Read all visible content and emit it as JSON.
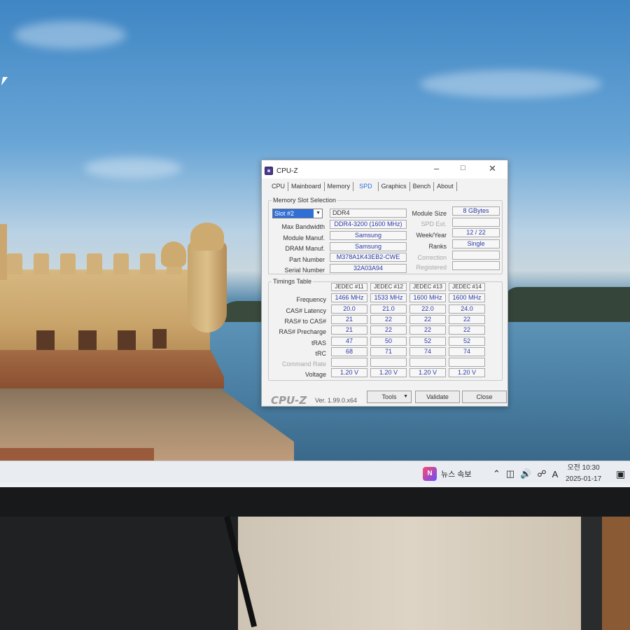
{
  "window": {
    "title": "CPU-Z",
    "minimize_icon": "minimize-icon",
    "maximize_icon": "maximize-icon",
    "close_icon": "close-icon"
  },
  "tabs": [
    "CPU",
    "Mainboard",
    "Memory",
    "SPD",
    "Graphics",
    "Bench",
    "About"
  ],
  "active_tab": "SPD",
  "slot_group": {
    "label": "Memory Slot Selection",
    "selected_slot": "Slot #2",
    "type": "DDR4",
    "module_size_label": "Module Size",
    "module_size": "8 GBytes",
    "spd_ext_label": "SPD Ext.",
    "week_year_label": "Week/Year",
    "week_year": "12 / 22",
    "ranks_label": "Ranks",
    "ranks": "Single",
    "correction_label": "Correction",
    "registered_label": "Registered",
    "max_bandwidth_label": "Max Bandwidth",
    "max_bandwidth": "DDR4-3200 (1600 MHz)",
    "module_manuf_label": "Module Manuf.",
    "module_manuf": "Samsung",
    "dram_manuf_label": "DRAM Manuf.",
    "dram_manuf": "Samsung",
    "part_number_label": "Part Number",
    "part_number": "M378A1K43EB2-CWE",
    "serial_number_label": "Serial Number",
    "serial_number": "32A03A94"
  },
  "timings": {
    "label": "Timings Table",
    "columns": [
      "JEDEC #11",
      "JEDEC #12",
      "JEDEC #13",
      "JEDEC #14"
    ],
    "rows": [
      {
        "label": "Frequency",
        "values": [
          "1466 MHz",
          "1533 MHz",
          "1600 MHz",
          "1600 MHz"
        ]
      },
      {
        "label": "CAS# Latency",
        "values": [
          "20.0",
          "21.0",
          "22.0",
          "24.0"
        ]
      },
      {
        "label": "RAS# to CAS#",
        "values": [
          "21",
          "22",
          "22",
          "22"
        ]
      },
      {
        "label": "RAS# Precharge",
        "values": [
          "21",
          "22",
          "22",
          "22"
        ]
      },
      {
        "label": "tRAS",
        "values": [
          "47",
          "50",
          "52",
          "52"
        ]
      },
      {
        "label": "tRC",
        "values": [
          "68",
          "71",
          "74",
          "74"
        ]
      },
      {
        "label": "Command Rate",
        "values": [
          "",
          "",
          "",
          ""
        ],
        "dim": true
      },
      {
        "label": "Voltage",
        "values": [
          "1.20 V",
          "1.20 V",
          "1.20 V",
          "1.20 V"
        ]
      }
    ]
  },
  "footer": {
    "logo": "CPU-Z",
    "version": "Ver. 1.99.0.x64",
    "tools_label": "Tools",
    "validate_label": "Validate",
    "close_label": "Close"
  },
  "taskbar": {
    "news_label": "뉴스 속보",
    "tray_icons": [
      "chevron-up-icon",
      "network-icon",
      "speaker-icon",
      "wifi-icon"
    ],
    "ime": "A",
    "time": "오전 10:30",
    "date": "2025-01-17"
  },
  "colors": {
    "active_tab": "#2a6fd6",
    "value_text": "#2a3aa6",
    "selection": "#2f6fd6"
  }
}
